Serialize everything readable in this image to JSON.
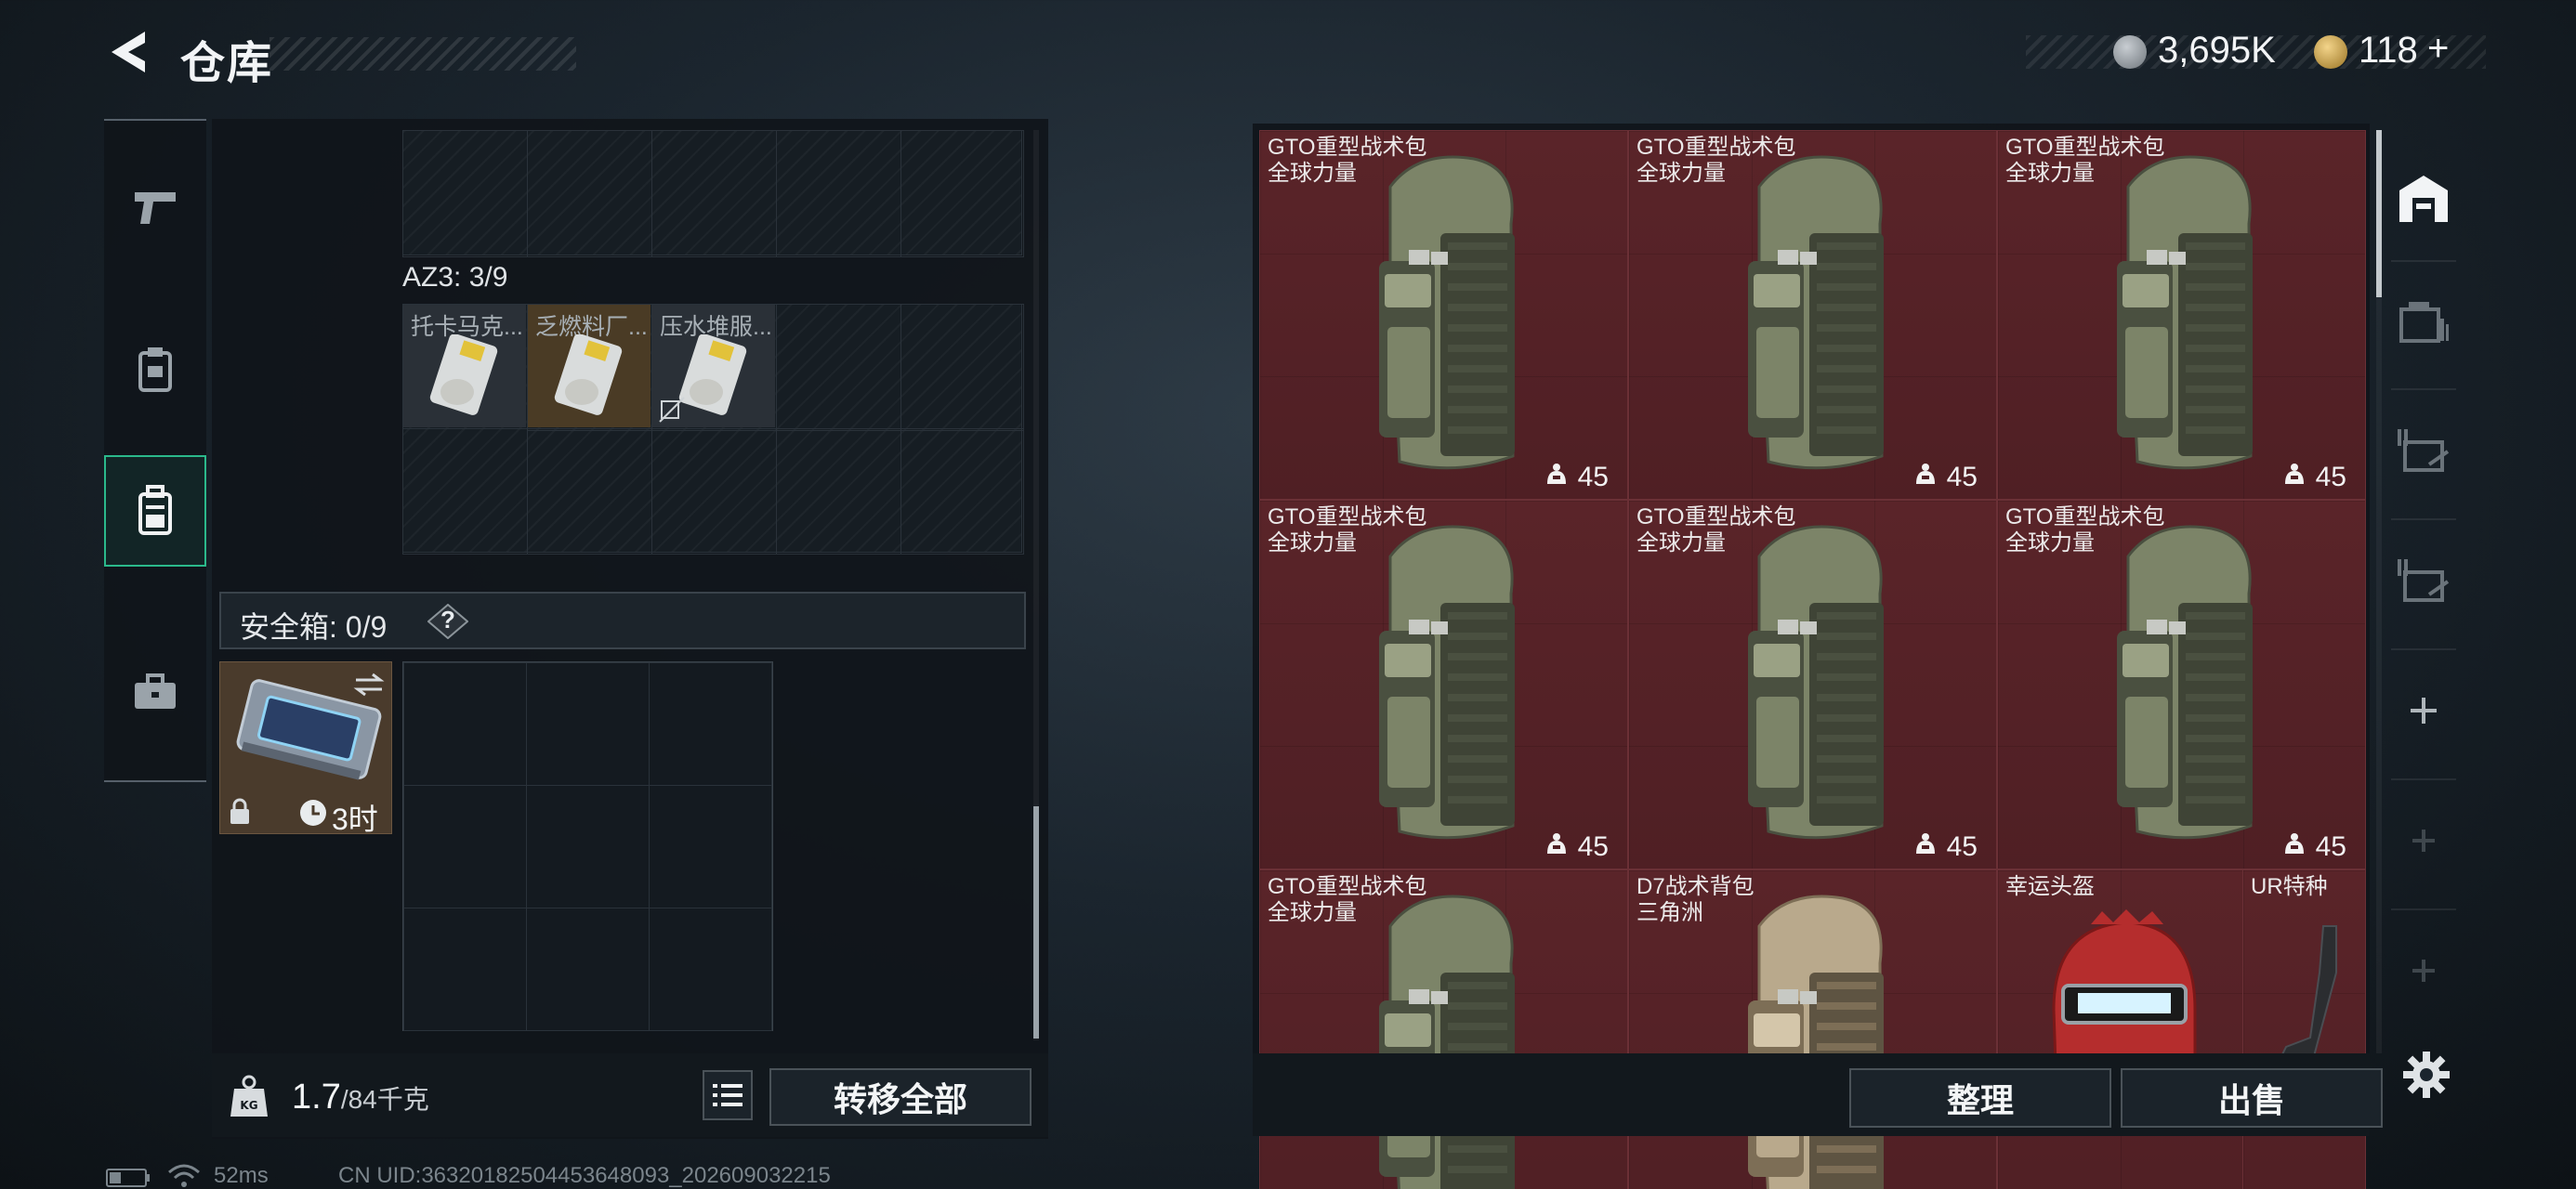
{
  "header": {
    "title": "仓库",
    "currency_silver": "3,695K",
    "currency_gold": "118",
    "gold_add": "+"
  },
  "left": {
    "az3_label": "AZ3: 3/9",
    "az3_items": [
      {
        "name": "托卡马克..."
      },
      {
        "name": "乏燃料厂..."
      },
      {
        "name": "压水堆服..."
      }
    ],
    "safe_label": "安全箱: 0/9",
    "safe_help": "?",
    "safe_case_timer": "3时",
    "weight_current": "1.7",
    "weight_max": "/84千克",
    "transfer_all": "转移全部"
  },
  "stash": {
    "items": [
      {
        "name": "GTO重型战术包",
        "sub": "全球力量",
        "cap": "45"
      },
      {
        "name": "GTO重型战术包",
        "sub": "全球力量",
        "cap": "45"
      },
      {
        "name": "GTO重型战术包",
        "sub": "全球力量",
        "cap": "45"
      },
      {
        "name": "GTO重型战术包",
        "sub": "全球力量",
        "cap": "45"
      },
      {
        "name": "GTO重型战术包",
        "sub": "全球力量",
        "cap": "45"
      },
      {
        "name": "GTO重型战术包",
        "sub": "全球力量",
        "cap": "45"
      },
      {
        "name": "GTO重型战术包",
        "sub": "全球力量",
        "cap": ""
      },
      {
        "name": "D7战术背包",
        "sub": "三角洲",
        "cap": ""
      },
      {
        "name": "幸运头盔",
        "sub": "",
        "cap": ""
      },
      {
        "name": "UR特种",
        "sub": "",
        "cap": ""
      }
    ],
    "sort_button": "整理",
    "sell_button": "出售"
  },
  "status": {
    "ping": "52ms",
    "uid": "CN UID:36320182504453648093_202609032215"
  },
  "colors": {
    "accent": "#2bb98b",
    "stash_item_bg": "#5a2429"
  }
}
